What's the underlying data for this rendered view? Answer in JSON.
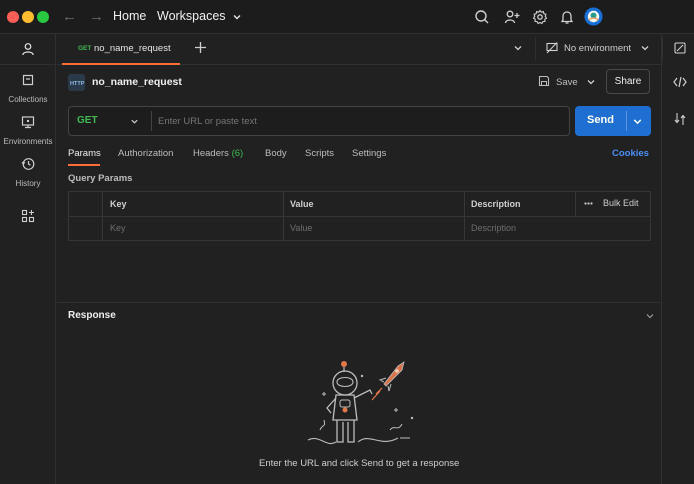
{
  "titlebar": {
    "home_label": "Home",
    "workspaces_label": "Workspaces"
  },
  "sidebar": {
    "items": [
      {
        "label": "Collections",
        "icon": "collections-icon"
      },
      {
        "label": "Environments",
        "icon": "environments-icon"
      },
      {
        "label": "History",
        "icon": "history-icon"
      }
    ]
  },
  "tabbar": {
    "tab": {
      "method": "GET",
      "name": "no_name_request"
    },
    "environment_label": "No environment"
  },
  "request": {
    "name": "no_name_request",
    "save_label": "Save",
    "share_label": "Share",
    "method": "GET",
    "url_placeholder": "Enter URL or paste text",
    "send_label": "Send",
    "tabs": [
      {
        "label": "Params",
        "active": true
      },
      {
        "label": "Authorization"
      },
      {
        "label": "Headers",
        "count": "(6)"
      },
      {
        "label": "Body"
      },
      {
        "label": "Scripts"
      },
      {
        "label": "Settings"
      }
    ],
    "cookies_label": "Cookies",
    "query_params_label": "Query Params",
    "table": {
      "headers": {
        "key": "Key",
        "value": "Value",
        "description": "Description",
        "bulk_edit": "Bulk Edit"
      },
      "placeholder_row": {
        "key": "Key",
        "value": "Value",
        "description": "Description"
      }
    }
  },
  "response": {
    "title": "Response",
    "empty_message": "Enter the URL and click Send to get a response"
  },
  "colors": {
    "accent_orange": "#ff6c37",
    "send_blue": "#1f6fd3",
    "method_get_green": "#3fb950",
    "cookies_blue": "#4b8ff7"
  }
}
